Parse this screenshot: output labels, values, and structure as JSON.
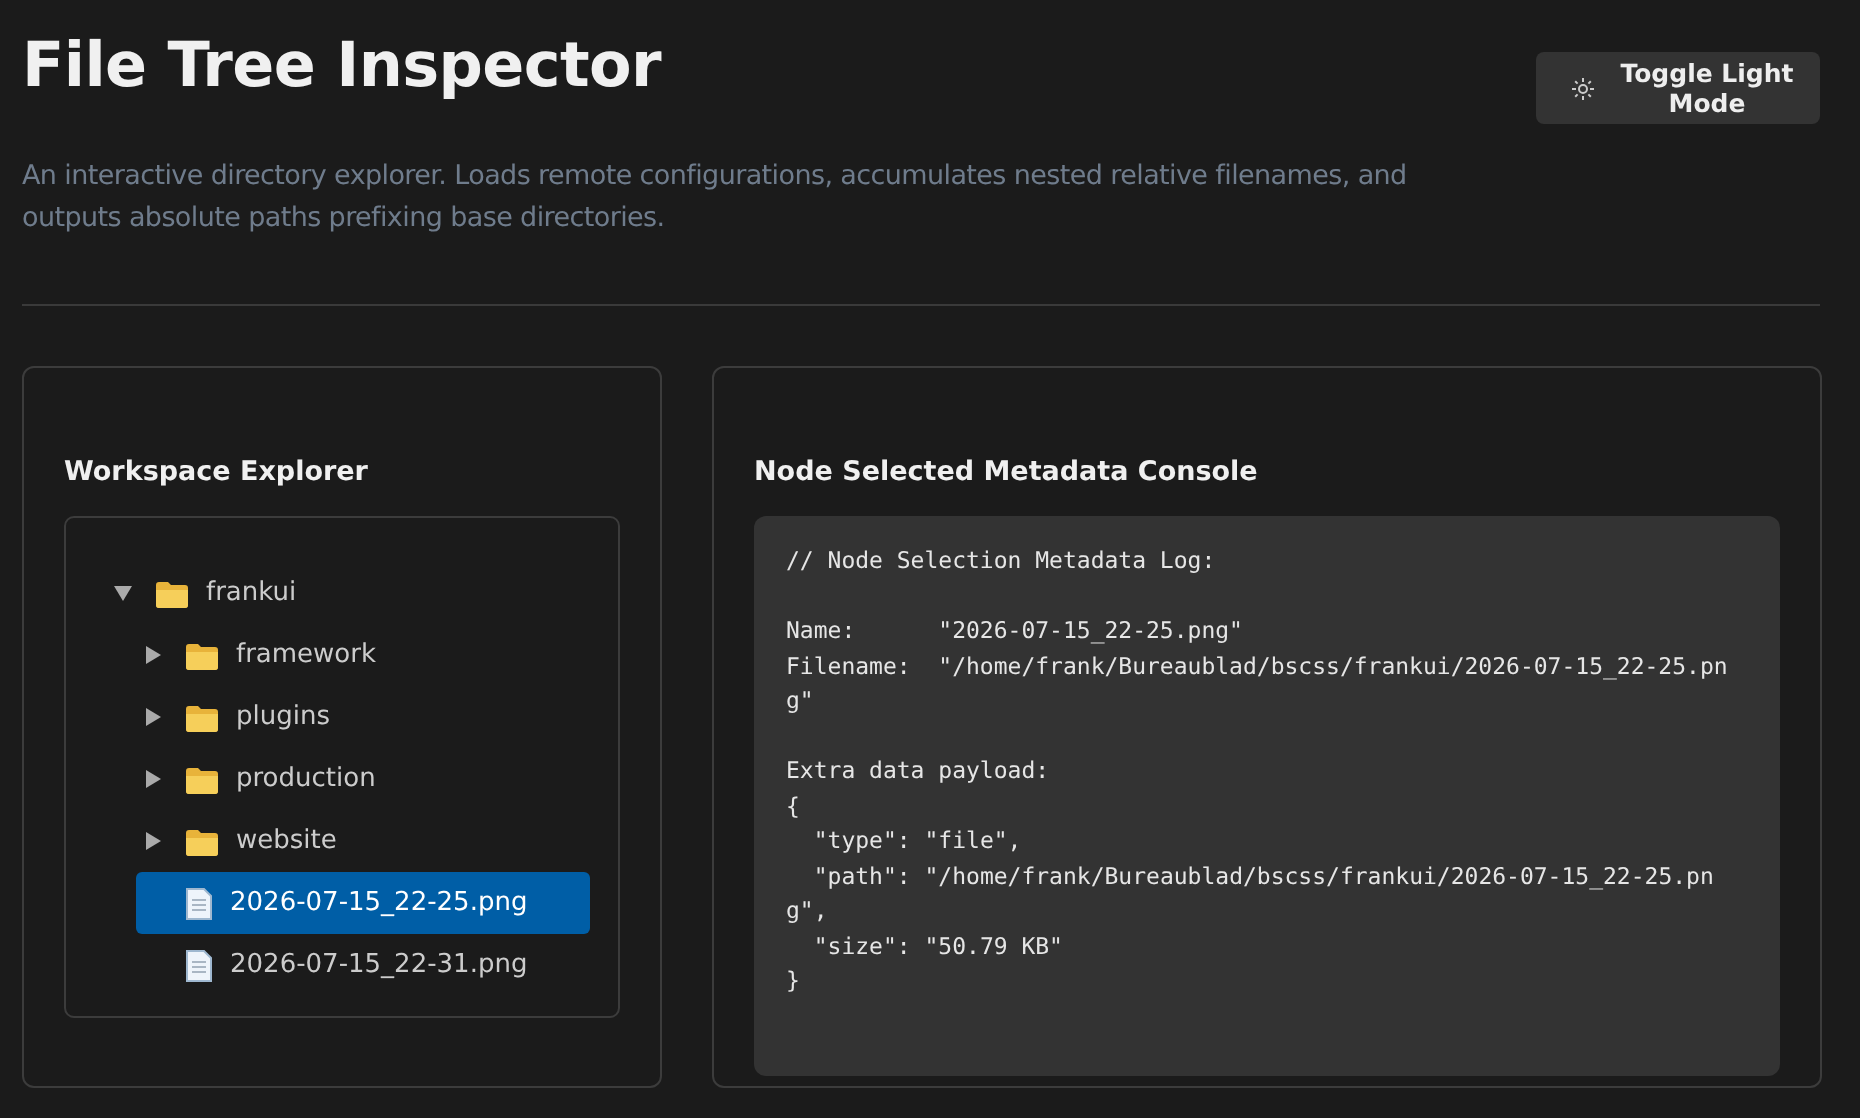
{
  "header": {
    "title": "File Tree Inspector",
    "description": "An interactive directory explorer. Loads remote configurations, accumulates nested relative filenames, and outputs absolute paths prefixing base directories.",
    "toggle_button": {
      "label": "Toggle Light Mode"
    }
  },
  "explorer": {
    "title": "Workspace Explorer",
    "tree": [
      {
        "name": "frankui",
        "kind": "folder",
        "expanded": true,
        "selected": false,
        "children": [
          {
            "name": "framework",
            "kind": "folder",
            "expanded": false,
            "selected": false
          },
          {
            "name": "plugins",
            "kind": "folder",
            "expanded": false,
            "selected": false
          },
          {
            "name": "production",
            "kind": "folder",
            "expanded": false,
            "selected": false
          },
          {
            "name": "website",
            "kind": "folder",
            "expanded": false,
            "selected": false
          },
          {
            "name": "2026-07-15_22-25.png",
            "kind": "file",
            "selected": true
          },
          {
            "name": "2026-07-15_22-31.png",
            "kind": "file",
            "selected": false
          }
        ]
      }
    ]
  },
  "console": {
    "title": "Node Selected Metadata Console",
    "log": "// Node Selection Metadata Log:\n\nName:      \"2026-07-15_22-25.png\"\nFilename:  \"/home/frank/Bureaublad/bscss/frankui/2026-07-15_22-25.png\"\n\nExtra data payload:\n{\n  \"type\": \"file\",\n  \"path\": \"/home/frank/Bureaublad/bscss/frankui/2026-07-15_22-25.png\",\n  \"size\": \"50.79 KB\"\n}"
  }
}
